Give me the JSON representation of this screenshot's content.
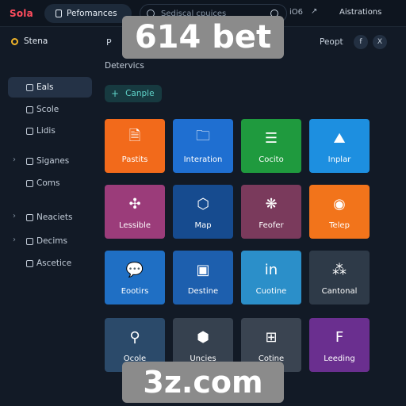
{
  "topbar": {
    "logo": "Sola",
    "tab_label": "Pefomances",
    "search_placeholder": "Sediscal cpuices",
    "extra": "iO6",
    "arrow": "↗",
    "user": "Aistrations"
  },
  "sidebar": {
    "header": "Stena",
    "items": [
      {
        "label": "Eals",
        "icon": "chat-icon",
        "active": true
      },
      {
        "label": "Scole",
        "icon": "box-icon"
      },
      {
        "label": "Lidis",
        "icon": "search-icon"
      },
      {
        "label": "Siganes",
        "icon": "location-icon",
        "chevron": true
      },
      {
        "label": "Coms",
        "icon": "pin-icon"
      },
      {
        "label": "Neaciets",
        "icon": "grid-icon",
        "chevron": true
      },
      {
        "label": "Decims",
        "icon": "layers-icon",
        "chevron": true
      },
      {
        "label": "Ascetice",
        "icon": "gauge-icon"
      }
    ]
  },
  "main": {
    "prefix": "P",
    "services_label": "Detervics",
    "compile_label": "Canple",
    "report_label": "Peopt",
    "icons": [
      "f",
      "X"
    ]
  },
  "tiles": [
    {
      "label": "Pastits",
      "color": "#f26a1b",
      "icon": "document-icon"
    },
    {
      "label": "Interation",
      "color": "#1f6fd1",
      "icon": "folder-icon"
    },
    {
      "label": "Cocito",
      "color": "#1f9a3e",
      "icon": "list-icon"
    },
    {
      "label": "Inplar",
      "color": "#1d8fe0",
      "icon": "image-icon"
    },
    {
      "label": "Lessible",
      "color": "#9b3c7a",
      "icon": "network-icon"
    },
    {
      "label": "Map",
      "color": "#164b8f",
      "icon": "hexagon-icon"
    },
    {
      "label": "Feofer",
      "color": "#7a3a5c",
      "icon": "brain-icon"
    },
    {
      "label": "Telep",
      "color": "#f2741b",
      "icon": "alert-icon"
    },
    {
      "label": "Eootirs",
      "color": "#1f6fc4",
      "icon": "speech-icon"
    },
    {
      "label": "Destine",
      "color": "#1d5fae",
      "icon": "gallery-icon"
    },
    {
      "label": "Cuotine",
      "color": "#2b8fc9",
      "icon": "linkedin-icon"
    },
    {
      "label": "Cantonal",
      "color": "#2e3a48",
      "icon": "nodes-icon"
    },
    {
      "label": "Ocole",
      "color": "#2b4a6a",
      "icon": "key-icon"
    },
    {
      "label": "Uncies",
      "color": "#36414f",
      "icon": "settings-icon"
    },
    {
      "label": "Cotine",
      "color": "#3a4451",
      "icon": "gift-icon"
    },
    {
      "label": "Leeding",
      "color": "#6a2f8f",
      "icon": "page-icon"
    }
  ],
  "watermark": {
    "top": "614 bet",
    "bottom": "3z.com"
  }
}
